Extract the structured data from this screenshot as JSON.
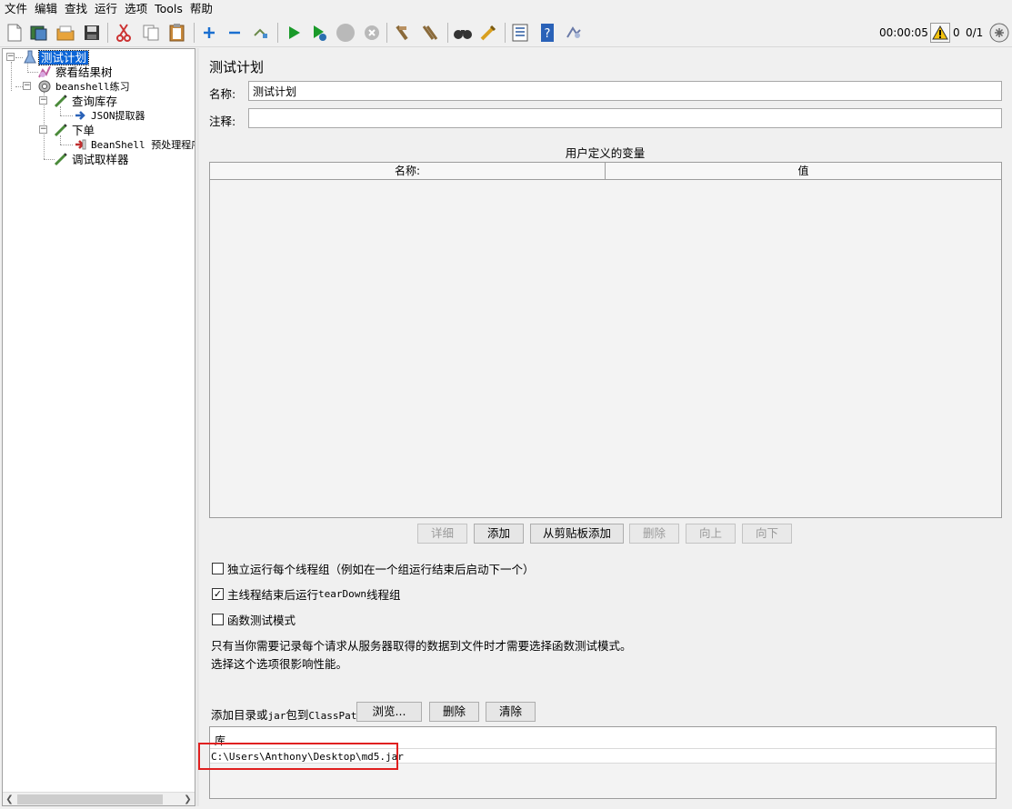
{
  "menu": [
    "文件",
    "编辑",
    "查找",
    "运行",
    "选项",
    "Tools",
    "帮助"
  ],
  "toolbar": {
    "timer": "00:00:05",
    "warning_count": "0",
    "threads": "0/1"
  },
  "tree": {
    "nodes": [
      "测试计划",
      "察看结果树",
      "beanshell练习",
      "查询库存",
      "JSON提取器",
      "下单",
      "BeanShell 预处理程序",
      "调试取样器"
    ]
  },
  "panel": {
    "title": "测试计划",
    "name_label": "名称:",
    "name_value": "测试计划",
    "comment_label": "注释:",
    "comment_value": "",
    "vars_title": "用户定义的变量",
    "columns": [
      "名称:",
      "值"
    ],
    "buttons": {
      "detail": "详细",
      "add": "添加",
      "add_clipboard": "从剪贴板添加",
      "delete": "删除",
      "up": "向上",
      "down": "向下"
    },
    "checks": {
      "independent": "独立运行每个线程组（例如在一个组运行结束后启动下一个）",
      "teardown_prefix": "主线程结束后运行 ",
      "teardown_mono": "tearDown",
      "teardown_suffix": "线程组",
      "functional": "函数测试模式"
    },
    "checks_state": {
      "independent": false,
      "teardown": true,
      "functional": false
    },
    "note_line1": "只有当你需要记录每个请求从服务器取得的数据到文件时才需要选择函数测试模式。",
    "note_line2": "选择这个选项很影响性能。",
    "classpath": {
      "label_prefix": "添加目录或",
      "label_mono": "jar",
      "label_mid": "包到",
      "label_mono2": "ClassPath",
      "browse": "浏览...",
      "delete": "删除",
      "clear": "清除",
      "lib_header": "库",
      "lib_row": "C:\\Users\\Anthony\\Desktop\\md5.jar"
    }
  },
  "colors": {
    "selection": "#0a64d6",
    "highlight": "#e02020",
    "run_green": "#1a9a2a",
    "add_blue": "#1a6fd0"
  }
}
